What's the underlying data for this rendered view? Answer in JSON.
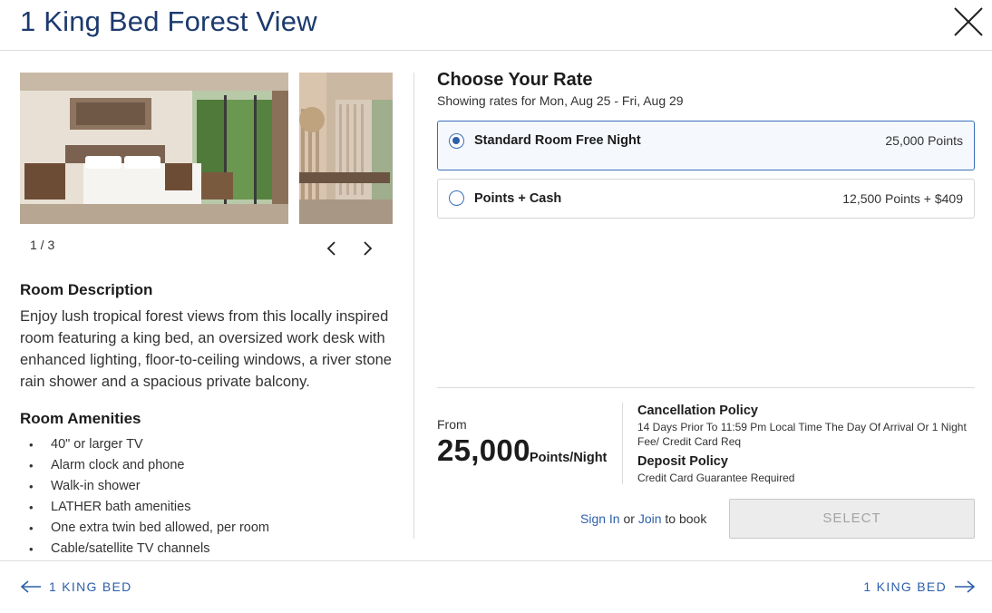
{
  "modal": {
    "title": "1 King Bed Forest View"
  },
  "gallery": {
    "counter": "1 / 3"
  },
  "room_description": {
    "heading": "Room Description",
    "text": "Enjoy lush tropical forest views from this locally inspired room featuring a king bed, an oversized work desk with enhanced lighting, floor-to-ceiling windows, a river stone rain shower and a spacious private balcony."
  },
  "room_amenities": {
    "heading": "Room Amenities",
    "items": [
      "40\" or larger TV",
      "Alarm clock and phone",
      "Walk-in shower",
      "LATHER bath amenities",
      "One extra twin bed allowed, per room",
      "Cable/satellite TV channels"
    ]
  },
  "rates": {
    "title": "Choose Your Rate",
    "subtitle": "Showing rates for Mon, Aug 25 - Fri, Aug 29",
    "options": [
      {
        "name": "Standard Room Free Night",
        "price": "25,000 Points",
        "selected": true
      },
      {
        "name": "Points + Cash",
        "price": "12,500 Points + $409",
        "selected": false
      }
    ]
  },
  "pricing": {
    "from_label": "From",
    "amount": "25,000",
    "unit": "Points/Night"
  },
  "policies": {
    "cancellation_heading": "Cancellation Policy",
    "cancellation_text": "14 Days Prior To 11:59 Pm Local Time The Day Of Arrival Or 1 Night Fee/ Credit Card Req",
    "deposit_heading": "Deposit Policy",
    "deposit_text": "Credit Card Guarantee Required"
  },
  "booking": {
    "sign_in": "Sign In",
    "or": "or",
    "join": "Join",
    "to_book": "to book",
    "select_label": "SELECT"
  },
  "footer": {
    "prev_label": "1 KING BED",
    "next_label": "1 KING BED"
  },
  "colors": {
    "accent": "#2d5faa",
    "title": "#1c3a6e",
    "disabled": "#ececec"
  }
}
